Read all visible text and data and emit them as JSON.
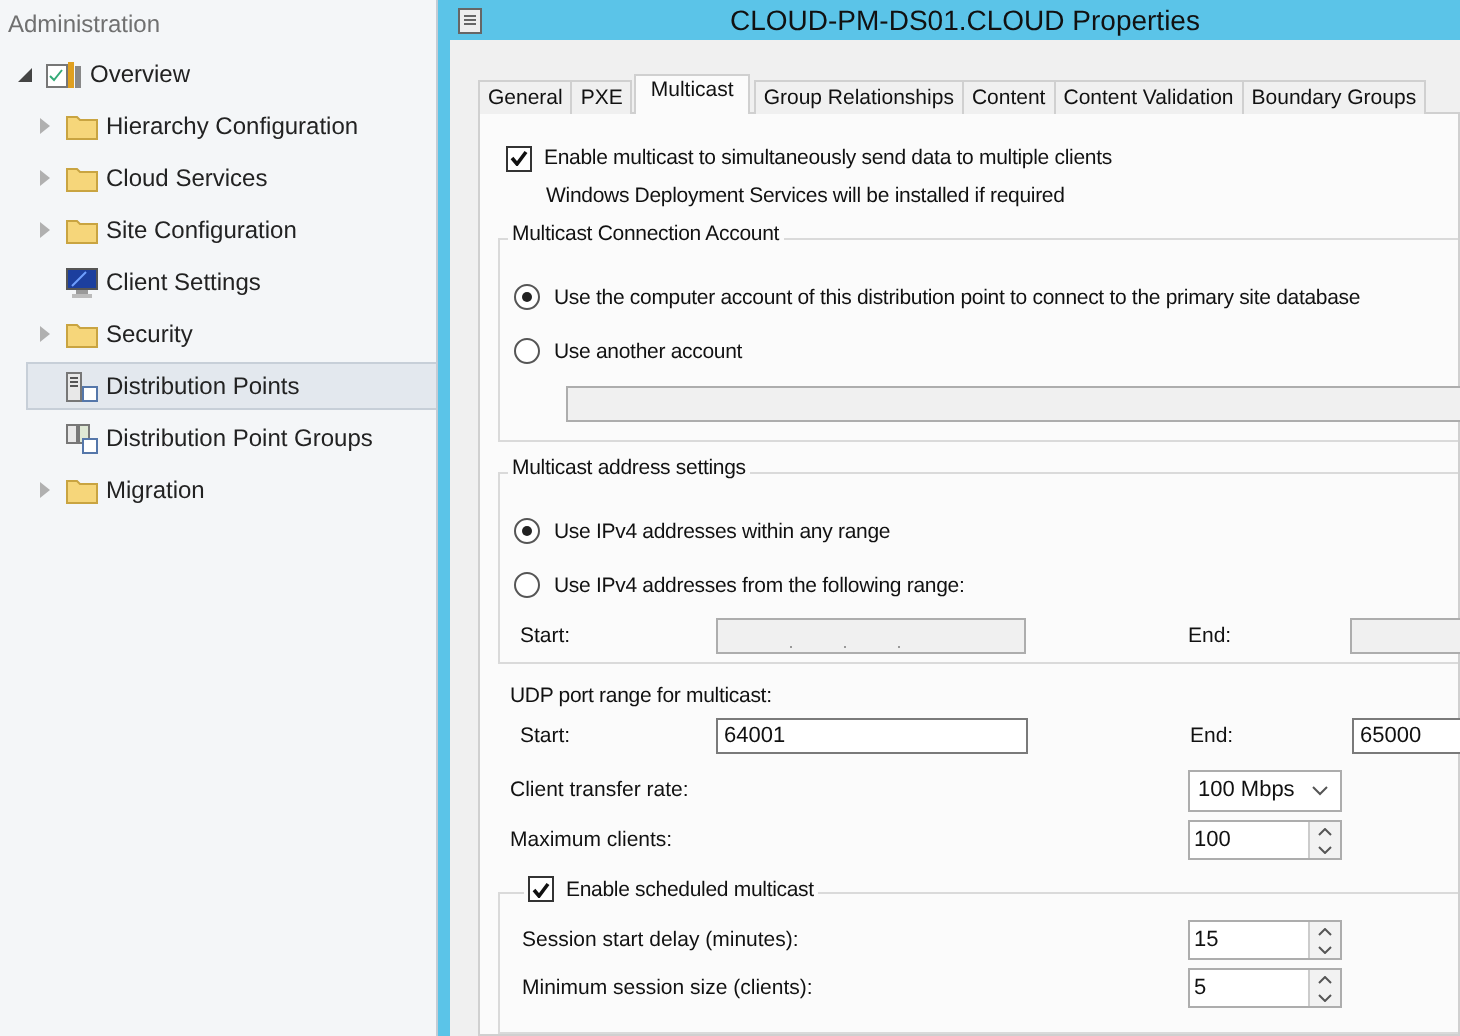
{
  "sidebar": {
    "title": "Administration",
    "tree": [
      {
        "label": "Overview",
        "kind": "overview",
        "expanded": true,
        "selected": false,
        "children": [
          {
            "label": "Hierarchy Configuration",
            "kind": "folder",
            "expandable": true,
            "selected": false
          },
          {
            "label": "Cloud Services",
            "kind": "folder",
            "expandable": true,
            "selected": false
          },
          {
            "label": "Site Configuration",
            "kind": "folder",
            "expandable": true,
            "selected": false
          },
          {
            "label": "Client Settings",
            "kind": "monitor",
            "expandable": false,
            "selected": false
          },
          {
            "label": "Security",
            "kind": "folder",
            "expandable": true,
            "selected": false
          },
          {
            "label": "Distribution Points",
            "kind": "server",
            "expandable": false,
            "selected": true
          },
          {
            "label": "Distribution Point Groups",
            "kind": "server-group",
            "expandable": false,
            "selected": false
          },
          {
            "label": "Migration",
            "kind": "folder",
            "expandable": true,
            "selected": false
          }
        ]
      }
    ]
  },
  "dialog": {
    "title": "CLOUD-PM-DS01.CLOUD Properties",
    "tabs": [
      {
        "label": "General",
        "selected": false
      },
      {
        "label": "PXE",
        "selected": false
      },
      {
        "label": "Multicast",
        "selected": true
      },
      {
        "label": "Group Relationships",
        "selected": false
      },
      {
        "label": "Content",
        "selected": false
      },
      {
        "label": "Content Validation",
        "selected": false
      },
      {
        "label": "Boundary Groups",
        "selected": false
      }
    ],
    "enable_multicast": {
      "label": "Enable multicast to simultaneously send data to multiple clients",
      "checked": true
    },
    "note": "Windows Deployment Services will be installed if required",
    "connection_account": {
      "title": "Multicast Connection Account",
      "options": [
        {
          "label": "Use the computer account of this distribution point to connect to the primary site database",
          "selected": true
        },
        {
          "label": "Use another account",
          "selected": false
        }
      ]
    },
    "address_settings": {
      "title": "Multicast address settings",
      "options": [
        {
          "label": "Use IPv4 addresses within any range",
          "selected": true
        },
        {
          "label": "Use IPv4 addresses from the following range:",
          "selected": false
        }
      ],
      "start_label": "Start:",
      "end_label": "End:"
    },
    "udp": {
      "title": "UDP port range for multicast:",
      "start_label": "Start:",
      "start_value": "64001",
      "end_label": "End:",
      "end_value": "65000"
    },
    "transfer_rate": {
      "label": "Client transfer rate:",
      "value": "100 Mbps"
    },
    "max_clients": {
      "label": "Maximum clients:",
      "value": "100"
    },
    "scheduled": {
      "label": "Enable scheduled multicast",
      "checked": true,
      "fields": [
        {
          "label": "Session start delay (minutes):",
          "value": "15"
        },
        {
          "label": "Minimum session size (clients):",
          "value": "5"
        }
      ]
    }
  }
}
